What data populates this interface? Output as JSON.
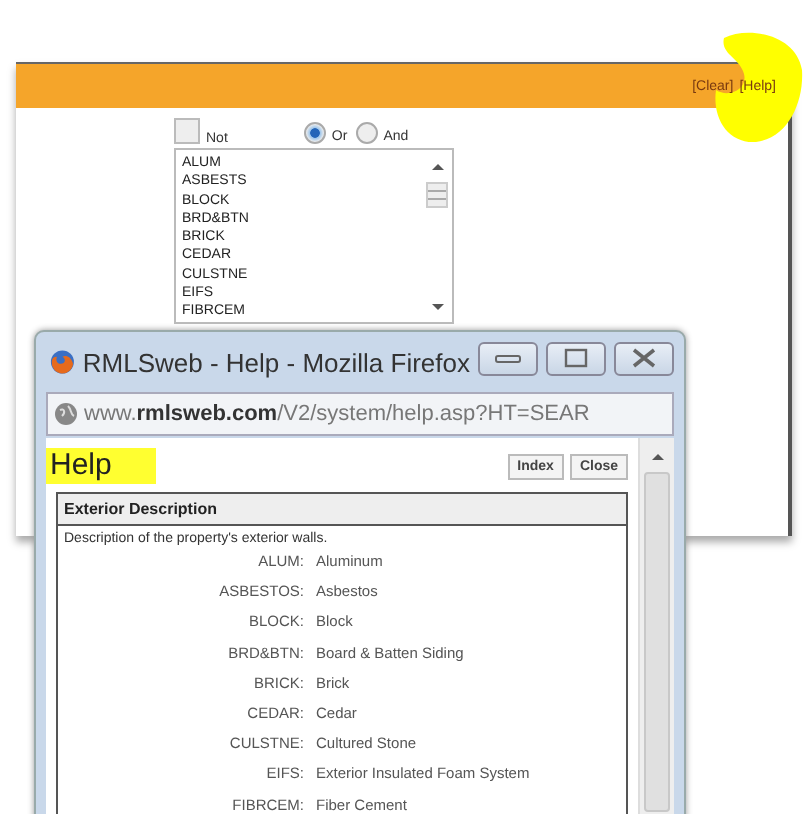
{
  "page": {
    "toolbar_links": [
      "[Clear]",
      "[Help]"
    ],
    "filter": {
      "not": {
        "label": "Not",
        "checked": false
      },
      "options": [
        {
          "label": "Or",
          "selected": true
        },
        {
          "label": "And",
          "selected": false
        }
      ],
      "list": [
        "ALUM",
        "ASBESTS",
        "BLOCK",
        "BRD&BTN",
        "BRICK",
        "CEDAR",
        "CULSTNE",
        "EIFS",
        "FIBRCEM"
      ]
    }
  },
  "popup": {
    "title": "RMLSweb - Help - Mozilla Firefox",
    "url": "www.**rmlsweb.com**/V2/system/help.asp?HT=SEAR",
    "heading": "Help",
    "buttons": [
      "Index",
      "Close"
    ],
    "section": {
      "title": "Exterior Description",
      "description": "Description of the property's exterior walls.",
      "rows": [
        {
          "code": "ALUM:",
          "meaning": "Aluminum"
        },
        {
          "code": "ASBESTOS:",
          "meaning": "Asbestos"
        },
        {
          "code": "BLOCK:",
          "meaning": "Block"
        },
        {
          "code": "BRD&BTN:",
          "meaning": "Board & Batten Siding"
        },
        {
          "code": "BRICK:",
          "meaning": "Brick"
        },
        {
          "code": "CEDAR:",
          "meaning": "Cedar"
        },
        {
          "code": "CULSTNE:",
          "meaning": "Cultured Stone"
        },
        {
          "code": "EIFS:",
          "meaning": "Exterior Insulated Foam System"
        },
        {
          "code": "FIBRCEM:",
          "meaning": "Fiber Cement"
        }
      ]
    }
  }
}
